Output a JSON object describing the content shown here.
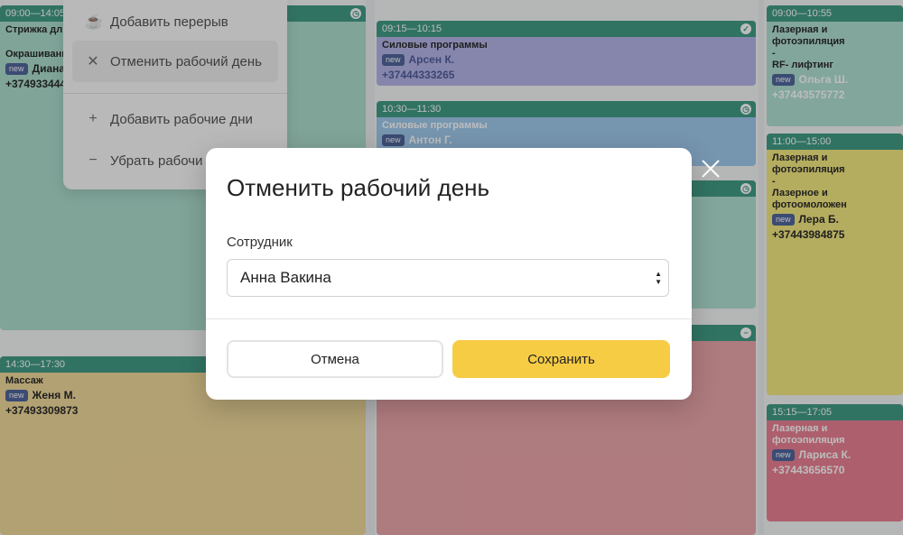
{
  "calendar": {
    "col1": [
      {
        "time": "09:00—14:05",
        "service": "Стрижка длинн",
        "service2": "Окрашивание",
        "badge": "new",
        "client": "Диана С.",
        "phone": "+37493344444",
        "head": "#1f8a70",
        "body": "#9ed8c6"
      },
      {
        "time": "14:30—17:30",
        "service": "Массаж",
        "badge": "new",
        "client": "Женя М.",
        "phone": "+37493309873",
        "head": "#1f8a70",
        "body": "#efd38a"
      }
    ],
    "col2": [
      {
        "time": "09:15—10:15",
        "service": "Силовые программы",
        "badge": "new",
        "client": "Арсен К.",
        "phone": "+37444333265",
        "head": "#1f8a70",
        "body": "#a8a8e6"
      },
      {
        "time": "10:30—11:30",
        "service": "Силовые программы",
        "badge": "new",
        "client": "Антон Г.",
        "phone": "",
        "head": "#1f8a70",
        "body": "#8fc0ea"
      }
    ],
    "col3": [
      {
        "time": "09:00—10:55",
        "service": "Лазерная и фотоэпиляция",
        "service2": "-",
        "service3": "RF- лифтинг",
        "badge": "new",
        "client": "Ольга Ш.",
        "phone": "+37443575772",
        "head": "#1f8a70",
        "body": "#a2dccb"
      },
      {
        "time": "11:00—15:00",
        "service": "Лазерная и фотоэпиляция",
        "service2": "-",
        "service3": "Лазерное и фотоомоложен",
        "badge": "new",
        "client": "Лера Б.",
        "phone": "+37443984875",
        "head": "#1f8a70",
        "body": "#f2e66a"
      },
      {
        "time": "15:15—17:05",
        "service": "Лазерная и фотоэпиляция",
        "badge": "new",
        "client": "Лариса К.",
        "phone": "+37443656570",
        "head": "#1f8a70",
        "body": "#e96a80"
      }
    ]
  },
  "menu": {
    "items": [
      "Добавить перерыв",
      "Отменить рабочий день",
      "Добавить рабочие дни",
      "Убрать рабочи"
    ]
  },
  "modal": {
    "title": "Отменить рабочий день",
    "employee_label": "Сотрудник",
    "employee_value": "Анна Вакина",
    "cancel_label": "Отмена",
    "save_label": "Сохранить"
  },
  "colors": {
    "accent": "#f6cc45",
    "status_head": "#1f8a70"
  }
}
